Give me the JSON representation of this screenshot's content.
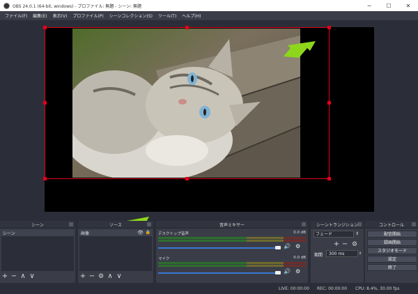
{
  "window": {
    "title": "OBS 24.0.1 (64-bit, windows) - プロファイル: 無題 - シーン: 無題",
    "minimize": "─",
    "maximize": "☐",
    "close": "✕"
  },
  "menu": [
    "ファイル(F)",
    "編集(E)",
    "表示(V)",
    "プロファイル(P)",
    "シーンコレクション(S)",
    "ツール(T)",
    "ヘルプ(H)"
  ],
  "preview": {
    "image_description_icon": "cat-photo",
    "arrow_color": "#8ed61c"
  },
  "docks": {
    "scenes": {
      "title": "シーン",
      "items": [
        "シーン"
      ]
    },
    "sources": {
      "title": "ソース",
      "items": [
        "画像"
      ]
    },
    "mixer": {
      "title": "音声ミキサー",
      "channels": [
        {
          "name": "デスクトップ音声",
          "db": "0.0 dB",
          "level": 0.94
        },
        {
          "name": "マイク",
          "db": "0.0 dB",
          "level": 0.94
        }
      ]
    },
    "transitions": {
      "title": "シーントランジション",
      "selected": "フェード",
      "duration_label": "期間",
      "duration_value": "300 ms"
    },
    "controls": {
      "title": "コントロール",
      "buttons": [
        "配信開始",
        "録画開始",
        "スタジオモード",
        "設定",
        "終了"
      ]
    }
  },
  "status": {
    "live": "LIVE: 00:00:00",
    "rec": "REC: 00:00:00",
    "cpu": "CPU: 8.4%, 30.00 fps"
  },
  "colors": {
    "accent": "#3a78d6",
    "selection_frame": "#e3001b",
    "arrow": "#8ed61c"
  }
}
